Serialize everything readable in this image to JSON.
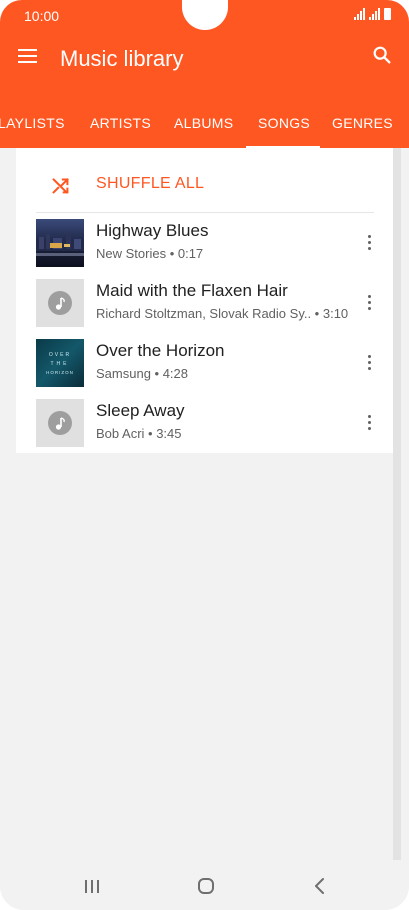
{
  "status": {
    "time": "10:00"
  },
  "appbar": {
    "title": "Music library",
    "menu_icon": "menu-icon",
    "search_icon": "search-icon"
  },
  "tabs": [
    {
      "label": "LAYLISTS"
    },
    {
      "label": "ARTISTS"
    },
    {
      "label": "ALBUMS"
    },
    {
      "label": "SONGS",
      "selected": true
    },
    {
      "label": "GENRES"
    }
  ],
  "shuffle": {
    "label": "SHUFFLE ALL",
    "icon": "shuffle-icon"
  },
  "songs": [
    {
      "title": "Highway Blues",
      "subtitle": "New Stories • 0:17",
      "art": "album-art-night-city"
    },
    {
      "title": "Maid with the Flaxen Hair",
      "subtitle": "Richard Stoltzman, Slovak Radio Sy..  • 3:10",
      "art": "music-note-icon"
    },
    {
      "title": "Over the Horizon",
      "subtitle": "Samsung • 4:28",
      "art": "album-art-over-the-horizon",
      "art_text": "O V E R   T H E   HORIZON"
    },
    {
      "title": "Sleep Away",
      "subtitle": "Bob Acri • 3:45",
      "art": "music-note-icon"
    }
  ],
  "nav": {
    "recents_icon": "recents-icon",
    "home_icon": "home-icon",
    "back_icon": "back-icon"
  },
  "colors": {
    "accent": "#ff5722",
    "background": "#f2f2f2",
    "text": "#212121",
    "secondary_text": "#616161"
  }
}
